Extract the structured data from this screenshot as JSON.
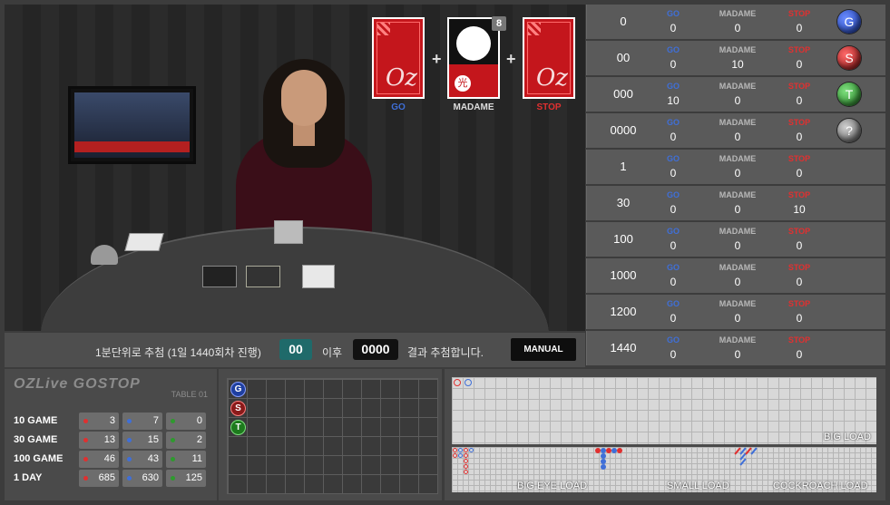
{
  "cards": {
    "go_label": "GO",
    "madame_label": "MADAME",
    "stop_label": "STOP",
    "madame_count": "8",
    "madame_kanji": "光",
    "card_logo": "Oz"
  },
  "bar": {
    "text1": "1분단위로 추첨 (1일 1440회차 진행)",
    "round": "00",
    "text2": "이후",
    "next": "0000",
    "text3": "결과 추첨합니다.",
    "manual": "MANUAL"
  },
  "colors": {
    "go": "#3f6fd8",
    "madame": "#b8b8b8",
    "stop": "#e03030",
    "tie": "#2e9a2e"
  },
  "results": {
    "headers": {
      "go": "GO",
      "madame": "MADAME",
      "stop": "STOP"
    },
    "rows": [
      {
        "key": "0",
        "go": "0",
        "madame": "0",
        "stop": "0",
        "ball": "G"
      },
      {
        "key": "00",
        "go": "0",
        "madame": "10",
        "stop": "0",
        "ball": "S"
      },
      {
        "key": "000",
        "go": "10",
        "madame": "0",
        "stop": "0",
        "ball": "T"
      },
      {
        "key": "0000",
        "go": "0",
        "madame": "0",
        "stop": "0",
        "ball": "?"
      },
      {
        "key": "1",
        "go": "0",
        "madame": "0",
        "stop": "0",
        "ball": ""
      },
      {
        "key": "30",
        "go": "0",
        "madame": "0",
        "stop": "10",
        "ball": ""
      },
      {
        "key": "100",
        "go": "0",
        "madame": "0",
        "stop": "0",
        "ball": ""
      },
      {
        "key": "1000",
        "go": "0",
        "madame": "0",
        "stop": "0",
        "ball": ""
      },
      {
        "key": "1200",
        "go": "0",
        "madame": "0",
        "stop": "0",
        "ball": ""
      },
      {
        "key": "1440",
        "go": "0",
        "madame": "0",
        "stop": "0",
        "ball": ""
      }
    ]
  },
  "stats": {
    "logo": "OZLive  GOSTOP",
    "table": "TABLE 01",
    "rows": [
      {
        "label": "10 GAME",
        "red": "3",
        "blue": "7",
        "green": "0"
      },
      {
        "label": "30 GAME",
        "red": "13",
        "blue": "15",
        "green": "2"
      },
      {
        "label": "100 GAME",
        "red": "46",
        "blue": "43",
        "green": "11"
      },
      {
        "label": "1 DAY",
        "red": "685",
        "blue": "630",
        "green": "125"
      }
    ]
  },
  "grid": {
    "balls": [
      "G",
      "S",
      "T"
    ]
  },
  "roads": {
    "big": "BIG LOAD",
    "big_eye": "BIG EYE LOAD",
    "small": "SMALL LOAD",
    "cockroach": "COCKROACH LOAD"
  }
}
